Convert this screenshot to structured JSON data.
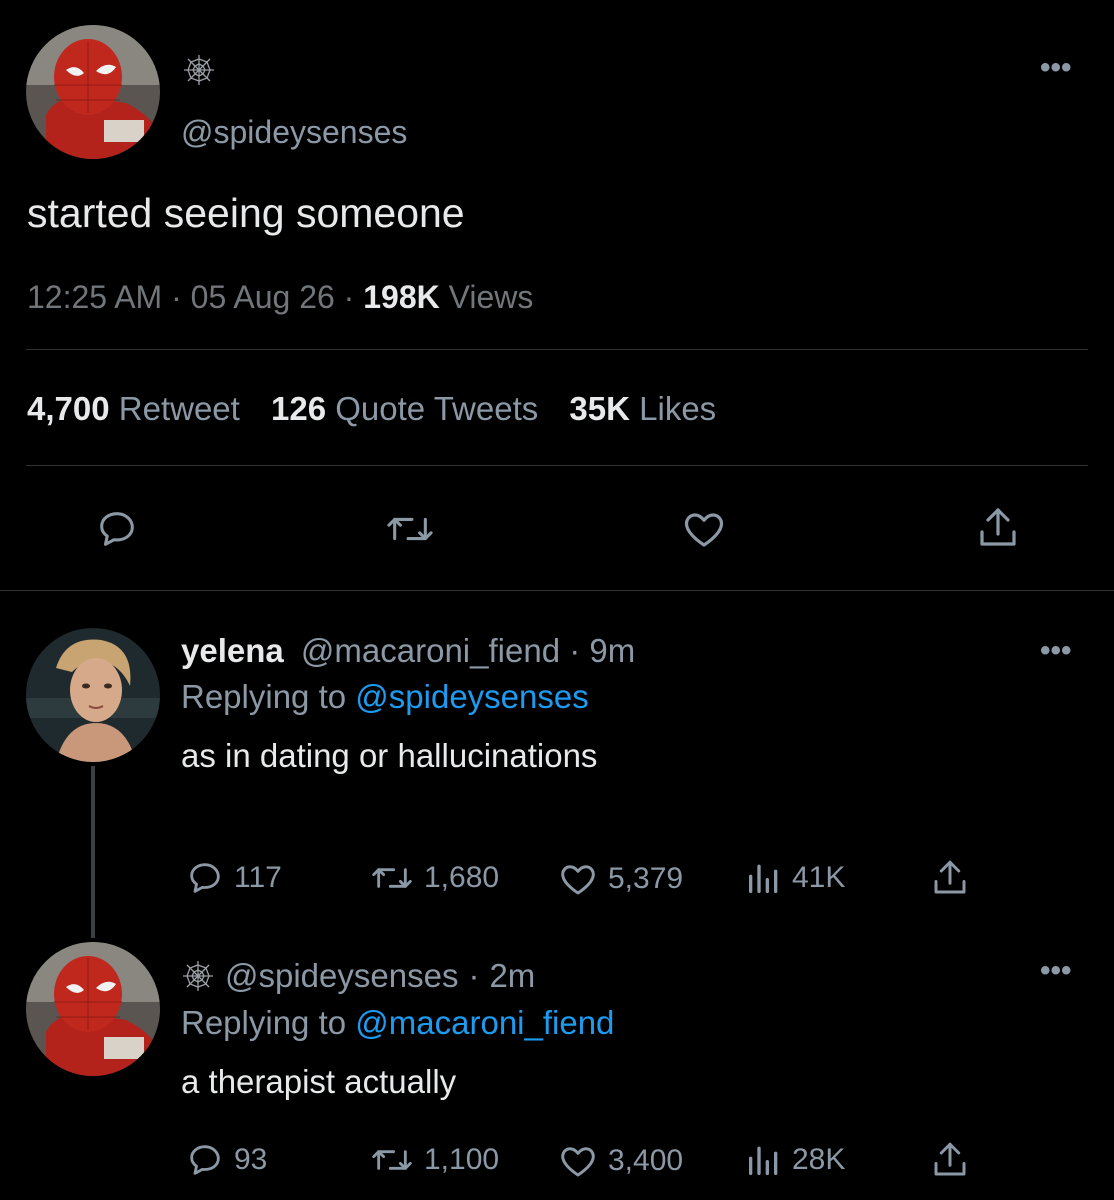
{
  "main_tweet": {
    "handle": "@spideysenses",
    "text": "started seeing someone",
    "time": "12:25 AM",
    "sep1": "·",
    "date": "05 Aug 26",
    "sep2": "·",
    "views_count": "198K",
    "views_label": "Views",
    "retweets_count": "4,700",
    "retweets_label": "Retweet",
    "quotes_count": "126",
    "quotes_label": "Quote Tweets",
    "likes_count": "35K",
    "likes_label": "Likes",
    "more": "•••"
  },
  "replies": [
    {
      "name": "yelena",
      "handle": "@macaroni_fiend",
      "sep": "·",
      "age": "9m",
      "replying_prefix": "Replying to",
      "replying_to": "@spideysenses",
      "text": "as in dating or hallucinations",
      "replies": "117",
      "retweets": "1,680",
      "likes": "5,379",
      "views": "41K",
      "more": "•••"
    },
    {
      "name": "",
      "handle": "@spideysenses",
      "sep": "·",
      "age": "2m",
      "replying_prefix": "Replying to",
      "replying_to": "@macaroni_fiend",
      "text": "a therapist actually",
      "replies": "93",
      "retweets": "1,100",
      "likes": "3,400",
      "views": "28K",
      "more": "•••"
    }
  ],
  "icons": [
    "web-icon",
    "reply-icon",
    "retweet-icon",
    "like-icon",
    "share-icon",
    "views-icon",
    "more-icon"
  ],
  "colors": {
    "background": "#000000",
    "text": "#e7e9ea",
    "muted": "#8b98a5",
    "link": "#1d9bf0",
    "divider": "#2f3336"
  }
}
